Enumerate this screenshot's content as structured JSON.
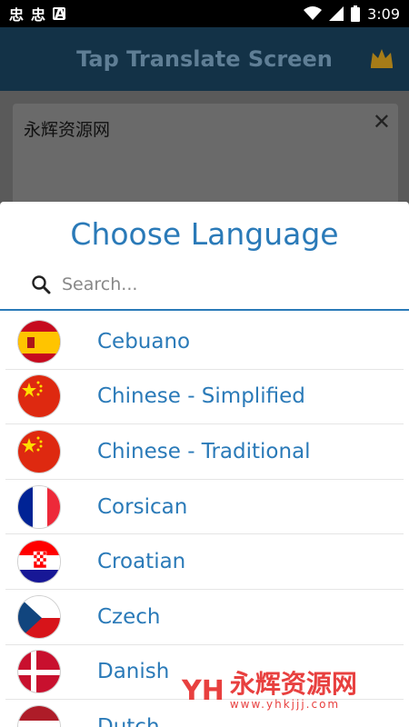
{
  "status_bar": {
    "left_icons": [
      "bug-icon",
      "bug-icon",
      "a-icon"
    ],
    "time": "3:09",
    "right_icons": [
      "wifi-icon",
      "signal-icon",
      "battery-icon"
    ]
  },
  "header": {
    "title": "Tap Translate Screen",
    "crown_icon": "crown-icon"
  },
  "background": {
    "text": "永辉资源网",
    "close_label": "✕"
  },
  "modal": {
    "title": "Choose Language",
    "search_placeholder": "Search...",
    "languages": [
      {
        "name": "Cebuano",
        "flag": "spain"
      },
      {
        "name": "Chinese - Simplified",
        "flag": "china"
      },
      {
        "name": "Chinese - Traditional",
        "flag": "china"
      },
      {
        "name": "Corsican",
        "flag": "france"
      },
      {
        "name": "Croatian",
        "flag": "croatia"
      },
      {
        "name": "Czech",
        "flag": "czech"
      },
      {
        "name": "Danish",
        "flag": "denmark"
      },
      {
        "name": "Dutch",
        "flag": "netherlands"
      }
    ]
  },
  "watermark": {
    "logo": "YH",
    "text_cn": "永辉资源网",
    "url": "www.yhkjjj.com"
  },
  "colors": {
    "accent": "#2a7ab8",
    "header_bg": "#133247",
    "watermark": "#e8403f"
  }
}
